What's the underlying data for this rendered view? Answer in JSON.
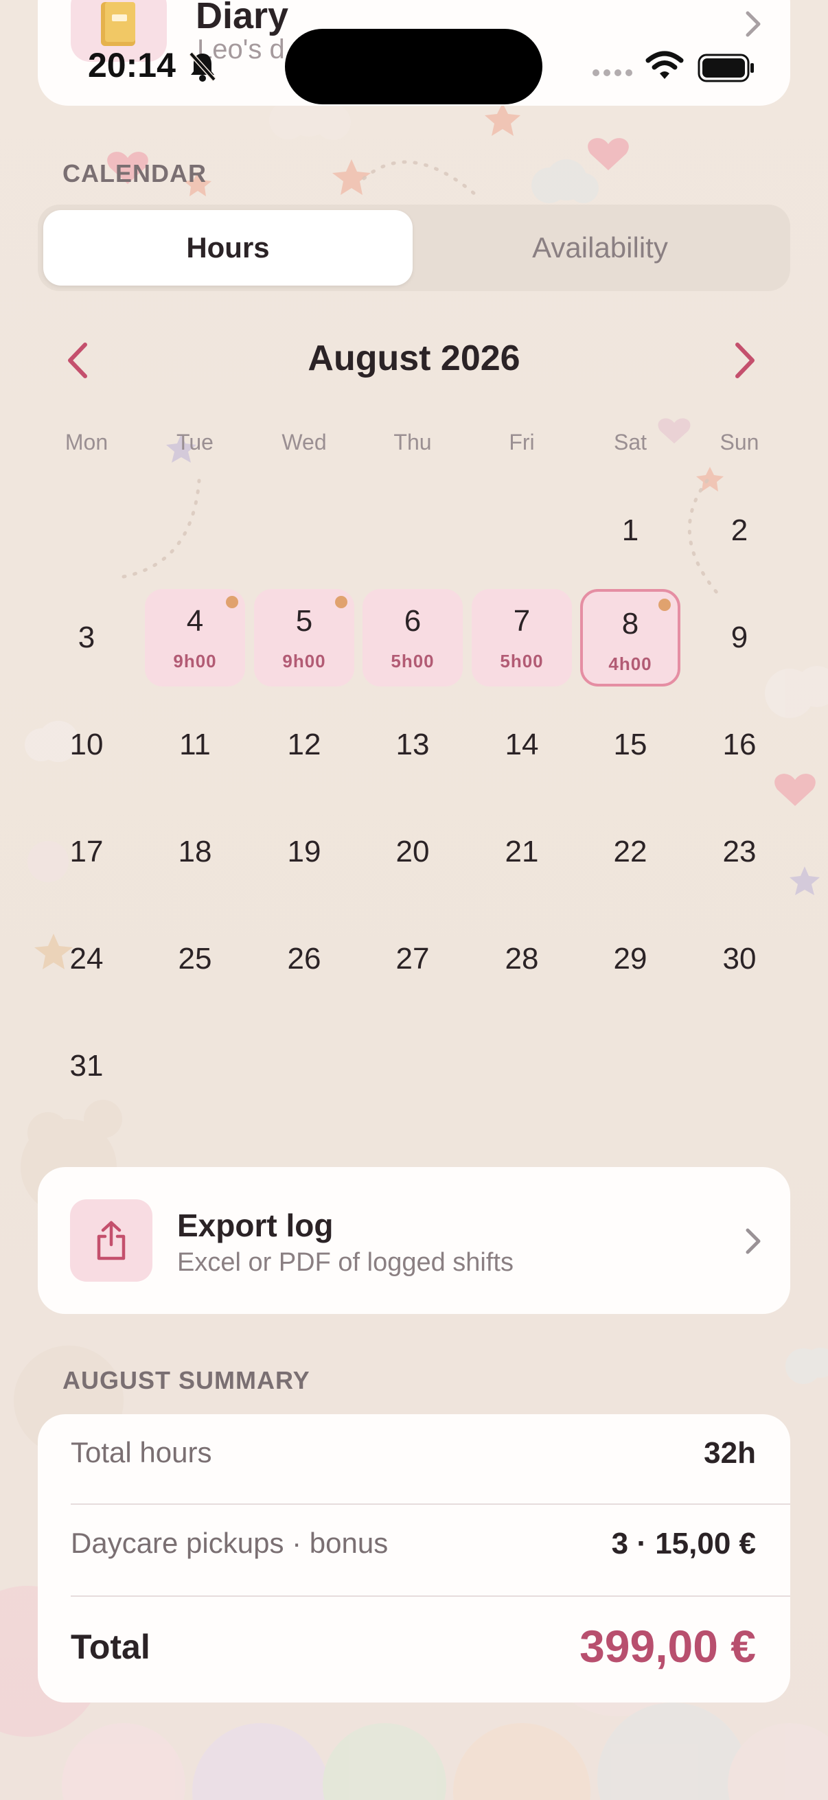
{
  "status_bar": {
    "time": "20:14"
  },
  "diary_card": {
    "title": "Diary",
    "subtitle": "Leo's d"
  },
  "calendar_section": {
    "label": "CALENDAR"
  },
  "segmented": {
    "options": [
      "Hours",
      "Availability"
    ],
    "selected": "Hours"
  },
  "calendar": {
    "month_title": "August 2026",
    "weekdays": [
      "Mon",
      "Tue",
      "Wed",
      "Thu",
      "Fri",
      "Sat",
      "Sun"
    ],
    "days": [
      {
        "num": "1"
      },
      {
        "num": "2"
      },
      {
        "num": "3"
      },
      {
        "num": "4",
        "hours": "9h00"
      },
      {
        "num": "5",
        "hours": "9h00"
      },
      {
        "num": "6",
        "hours": "5h00"
      },
      {
        "num": "7",
        "hours": "5h00"
      },
      {
        "num": "8",
        "hours": "4h00"
      },
      {
        "num": "9"
      },
      {
        "num": "10"
      },
      {
        "num": "11"
      },
      {
        "num": "12"
      },
      {
        "num": "13"
      },
      {
        "num": "14"
      },
      {
        "num": "15"
      },
      {
        "num": "16"
      },
      {
        "num": "17"
      },
      {
        "num": "18"
      },
      {
        "num": "19"
      },
      {
        "num": "20"
      },
      {
        "num": "21"
      },
      {
        "num": "22"
      },
      {
        "num": "23"
      },
      {
        "num": "24"
      },
      {
        "num": "25"
      },
      {
        "num": "26"
      },
      {
        "num": "27"
      },
      {
        "num": "28"
      },
      {
        "num": "29"
      },
      {
        "num": "30"
      },
      {
        "num": "31"
      }
    ]
  },
  "export_card": {
    "title": "Export log",
    "subtitle": "Excel or PDF of logged shifts"
  },
  "summary": {
    "section_label": "AUGUST SUMMARY",
    "rows": [
      {
        "label": "Total hours",
        "value": "32h"
      },
      {
        "label": "Daycare pickups · bonus",
        "value": "3 · 15,00 €"
      }
    ],
    "total_label": "Total",
    "total_value": "399,00 €"
  },
  "colors": {
    "accent": "#b84f6e",
    "dot": "#e0a26e",
    "filled_day": "#f8dce2"
  },
  "icons": [
    "bell-slash-icon",
    "wifi-icon",
    "battery-icon",
    "chevron-left-icon",
    "chevron-right-icon",
    "share-icon",
    "diary-icon"
  ]
}
